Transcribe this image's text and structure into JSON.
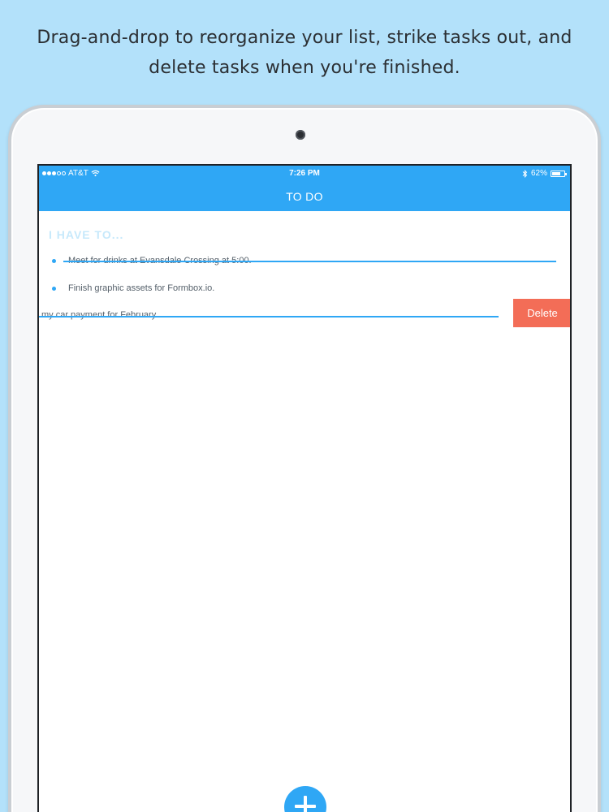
{
  "caption": {
    "line1": "Drag-and-drop to reorganize your list, strike tasks out, and",
    "line2": "delete tasks when you're finished."
  },
  "status_bar": {
    "carrier": "AT&T",
    "time": "7:26 PM",
    "battery": "62%",
    "signal_bars_filled": 3,
    "signal_bars_total": 5
  },
  "nav": {
    "title": "TO DO"
  },
  "list": {
    "header": "I HAVE TO...",
    "tasks": [
      {
        "text": "Meet for drinks at Evansdale Crossing at 5:00.",
        "struck": true
      },
      {
        "text": "Finish graphic assets for Formbox.io.",
        "struck": false
      },
      {
        "text": "my car payment for February.",
        "struck": true
      }
    ]
  },
  "actions": {
    "delete_label": "Delete"
  },
  "colors": {
    "accent": "#2fa7f5",
    "delete": "#f36d57",
    "background": "#b3e1fa"
  },
  "icons": [
    "wifi-icon",
    "bluetooth-icon",
    "battery-icon",
    "plus-icon"
  ]
}
